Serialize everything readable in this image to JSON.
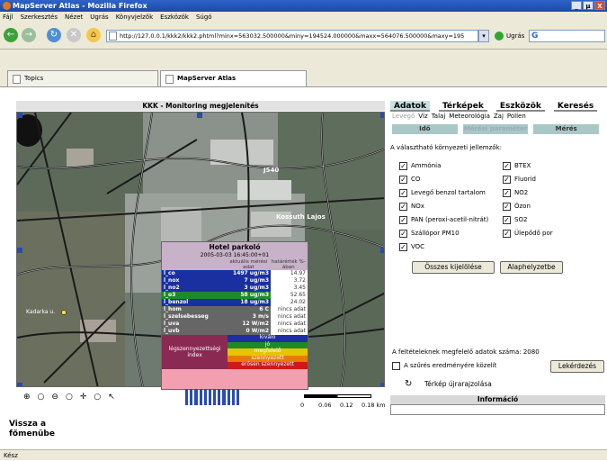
{
  "window": {
    "title": "MapServer Atlas - Mozilla Firefox",
    "controls": [
      "_",
      "µ",
      "X"
    ]
  },
  "menu": [
    "Fájl",
    "Szerkesztés",
    "Nézet",
    "Ugrás",
    "Könyvjelzők",
    "Eszközök",
    "Súgó"
  ],
  "nav": {
    "back": "←",
    "forward": "→",
    "reload": "↻",
    "stop": "✕",
    "home": "⌂",
    "url": "http://127.0.0.1/kkk2/kkk2.phtml?minx=563032.500000&miny=194524.000000&maxx=564076.500000&maxy=195",
    "go_label": "Ugrás",
    "search_logo": "G"
  },
  "tabs": [
    {
      "label": "Topics"
    },
    {
      "label": "MapServer Atlas"
    }
  ],
  "map": {
    "title": "KKK - Monitoring megjelenítés",
    "street_labels": [
      "Kossuth Lajos",
      "J540",
      "Kadarka u."
    ],
    "popup": {
      "title": "Hotel parkoló",
      "timestamp": "2005-03-03 16:45:00+01",
      "col_current": "aktuális mérési adat",
      "col_limit": "határérték %-ában",
      "rows": [
        {
          "name": "l_co",
          "value": "1497 ug/m3",
          "pct": "14.97",
          "color": "#1a2fa0"
        },
        {
          "name": "l_nox",
          "value": "7 ug/m3",
          "pct": "3.72",
          "color": "#1a2fa0"
        },
        {
          "name": "l_no2",
          "value": "3 ug/m3",
          "pct": "3.45",
          "color": "#1a2fa0"
        },
        {
          "name": "l_o3",
          "value": "58 ug/m3",
          "pct": "52.65",
          "color": "#1d8a2a"
        },
        {
          "name": "l_benzol",
          "value": "18 ug/m3",
          "pct": "24.02",
          "color": "#1a2fa0"
        },
        {
          "name": "l_hom",
          "value": "6 C",
          "pct": "nincs adat",
          "color": "#666666"
        },
        {
          "name": "l_szelsebesseg",
          "value": "3 m/s",
          "pct": "nincs adat",
          "color": "#666666"
        },
        {
          "name": "l_uva",
          "value": "12 W/m2",
          "pct": "nincs adat",
          "color": "#666666"
        },
        {
          "name": "l_uvb",
          "value": "0 W/m2",
          "pct": "nincs adat",
          "color": "#666666"
        }
      ],
      "index_label": "légszennyezettségi index",
      "index_levels": [
        {
          "label": "kiváló",
          "color": "#1a2fa0"
        },
        {
          "label": "jó",
          "color": "#1d8a2a"
        },
        {
          "label": "megfelelő",
          "color": "#e8c400"
        },
        {
          "label": "szennyezett",
          "color": "#e87a00"
        },
        {
          "label": "erősen szennyezett",
          "color": "#d01818"
        }
      ]
    },
    "tools": [
      "⊕",
      "○",
      "⊖",
      "○",
      "✛",
      "○",
      "↖"
    ],
    "scale_labels": [
      "0",
      "0.06",
      "0.12",
      "0.18 km"
    ]
  },
  "back_link": "Vissza a főmenübe",
  "side": {
    "tabs": [
      "Adatok",
      "Térképek",
      "Eszközök",
      "Keresés"
    ],
    "subtabs": [
      "Levegő",
      "Víz",
      "Talaj",
      "Meteorológia",
      "Zaj",
      "Pollen"
    ],
    "filters": [
      "Idő",
      "Mérési paraméter",
      "Mérés"
    ],
    "choose_label": "A választható környezeti jellemzők:",
    "features": [
      "Ammónia",
      "BTEX",
      "CO",
      "Fluorid",
      "Levegő benzol tartalom",
      "NO2",
      "NOx",
      "Ózon",
      "PAN (peroxi-acetil-nitrát)",
      "SO2",
      "Szállópor PM10",
      "Ülepődő por",
      "VOC"
    ],
    "select_all": "Összes kijelölése",
    "reset": "Alaphelyzetbe",
    "count_text": "A feltételeknek megfelelő adatok száma: 2080",
    "focus_label": "A szűrés eredményére közelít",
    "query": "Lekérdezés",
    "redraw": "Térkép újrarajzolása",
    "info_header": "Információ"
  },
  "status": "Kész"
}
